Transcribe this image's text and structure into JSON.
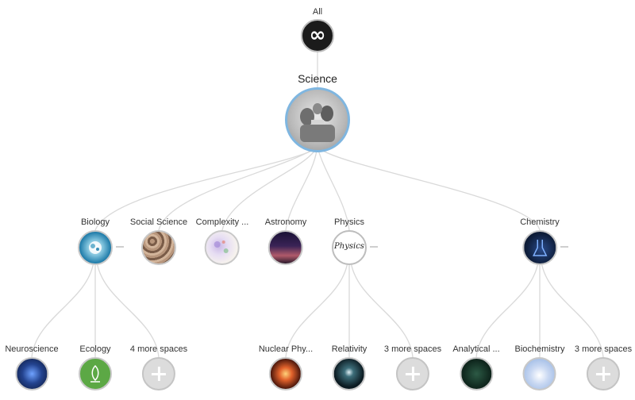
{
  "root": {
    "label": "All",
    "icon": "infinity-icon",
    "glyph": "∞"
  },
  "main": {
    "label": "Science",
    "icon": "science-photo"
  },
  "children": [
    {
      "label": "Biology",
      "icon": "biology-icon"
    },
    {
      "label": "Social Science",
      "icon": "social-science-icon"
    },
    {
      "label": "Complexity ...",
      "icon": "complexity-icon"
    },
    {
      "label": "Astronomy",
      "icon": "astronomy-icon"
    },
    {
      "label": "Physics",
      "icon": "physics-icon",
      "text": "Physics"
    },
    {
      "label": "Chemistry",
      "icon": "chemistry-icon"
    }
  ],
  "grandchildren": [
    {
      "label": "Neuroscience",
      "icon": "neuroscience-icon"
    },
    {
      "label": "Ecology",
      "icon": "ecology-icon"
    },
    {
      "label": "4 more spaces",
      "icon": "plus-icon"
    },
    {
      "label": "Nuclear Phy...",
      "icon": "nuclear-physics-icon"
    },
    {
      "label": "Relativity",
      "icon": "relativity-icon"
    },
    {
      "label": "3 more spaces",
      "icon": "plus-icon"
    },
    {
      "label": "Analytical ...",
      "icon": "analytical-chemistry-icon"
    },
    {
      "label": "Biochemistry",
      "icon": "biochemistry-icon"
    },
    {
      "label": "3 more spaces",
      "icon": "plus-icon"
    }
  ],
  "colors": {
    "link": "#d9d9d9",
    "selected_border": "#7fb6e0",
    "plus_bg": "#dcdcdc"
  }
}
